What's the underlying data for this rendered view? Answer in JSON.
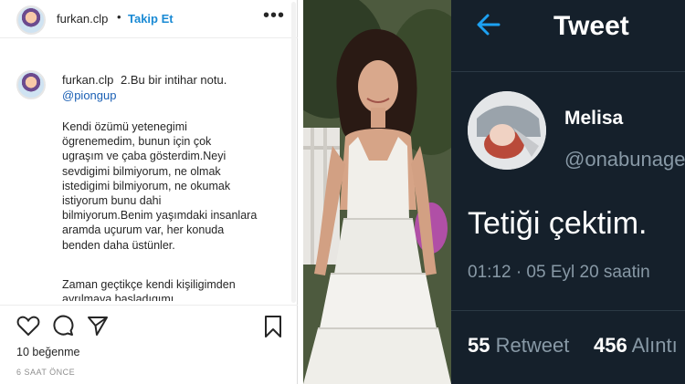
{
  "instagram": {
    "username": "furkan.clp",
    "separator": "•",
    "follow_label": "Takip Et",
    "more": "•••",
    "caption": {
      "username": "furkan.clp",
      "title": "2.Bu bir intihar notu.",
      "mention": "@piongup",
      "body": "Kendi özümü yetenegimi\nögrenemedim, bunun için çok\nugraşım ve çaba gösterdim.Neyi\nsevdigimi bilmiyorum, ne olmak\nistedigimi bilmiyorum, ne okumak\nistiyorum bunu dahi\nbilmiyorum.Benim yaşımdaki insanlara\naramda uçurum var, her konuda\nbenden daha üstünler.",
      "body_continued": "Zaman geçtikçe kendi kişiligimden\nayrılmaya başladıgımı"
    },
    "likes": "10 beğenme",
    "time": "6 SAAT ÖNCE",
    "icons": [
      "heart-icon",
      "comment-icon",
      "share-icon",
      "bookmark-icon"
    ]
  },
  "twitter": {
    "title": "Tweet",
    "name": "Melisa",
    "handle": "@onabunage",
    "text": "Tetiği çektim.",
    "meta": "01:12 · 05 Eyl 20 saatin",
    "retweet_count": "55",
    "retweet_label": "Retweet",
    "quote_count": "456",
    "quote_label": "Alıntı",
    "icons": [
      "back-arrow-icon"
    ]
  },
  "colors": {
    "instagram_link": "#1a8ad4",
    "twitter_background": "#15202b",
    "twitter_accent": "#1da1f2",
    "twitter_secondary": "#8899a6"
  }
}
